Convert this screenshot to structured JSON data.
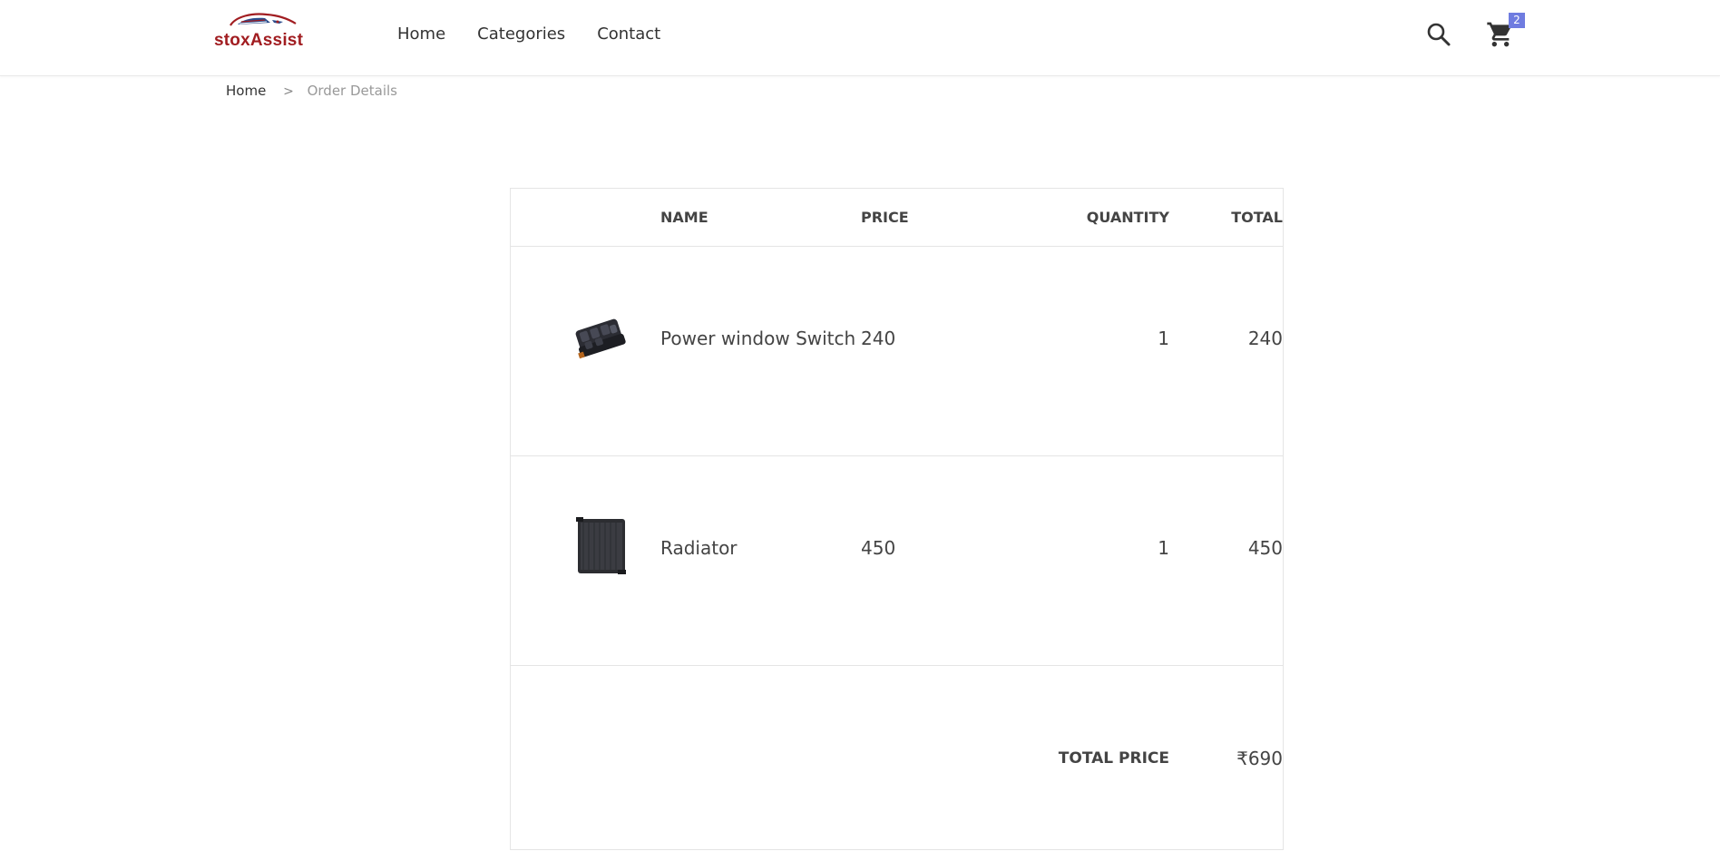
{
  "brand": {
    "name": "stoxAssist",
    "color": "#a11d21"
  },
  "nav": {
    "items": [
      {
        "label": "Home"
      },
      {
        "label": "Categories"
      },
      {
        "label": "Contact"
      }
    ]
  },
  "header_icons": {
    "search": "search-icon",
    "cart": "cart-icon",
    "cart_count": "2",
    "badge_color": "#6f7ce0"
  },
  "breadcrumb": {
    "home": "Home",
    "separator": ">",
    "current": "Order Details"
  },
  "table": {
    "columns": {
      "name": "NAME",
      "price": "PRICE",
      "quantity": "QUANTITY",
      "total": "TOTAL"
    },
    "rows": [
      {
        "name": "Power window Switch",
        "price": "240",
        "quantity": "1",
        "total": "240",
        "image": "power-window-switch-image"
      },
      {
        "name": "Radiator",
        "price": "450",
        "quantity": "1",
        "total": "450",
        "image": "radiator-image"
      }
    ],
    "total_label": "TOTAL PRICE",
    "total_value": "₹690"
  }
}
